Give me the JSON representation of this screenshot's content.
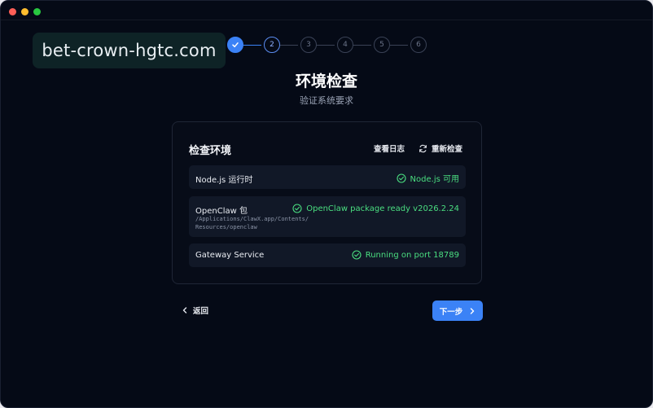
{
  "watermark": "bet-crown-hgtc.com",
  "stepper": {
    "steps": [
      "✓",
      "2",
      "3",
      "4",
      "5",
      "6"
    ],
    "completed": 1,
    "active_step": 2
  },
  "page": {
    "title": "环境检查",
    "subtitle": "验证系统要求"
  },
  "card": {
    "title": "检查环境",
    "view_logs_label": "查看日志",
    "recheck_label": "重新检查",
    "checks": [
      {
        "label": "Node.js 运行时",
        "status": "Node.js 可用"
      },
      {
        "label": "OpenClaw 包",
        "path": "/Applications/ClawX.app/Contents/Resources/openclaw",
        "status": "OpenClaw package ready v2026.2.24"
      },
      {
        "label": "Gateway Service",
        "status": "Running on port 18789"
      }
    ]
  },
  "footer": {
    "back_label": "返回",
    "next_label": "下一步"
  },
  "colors": {
    "background": "#050a16",
    "accent": "#3b82f6",
    "success": "#4ade80"
  }
}
